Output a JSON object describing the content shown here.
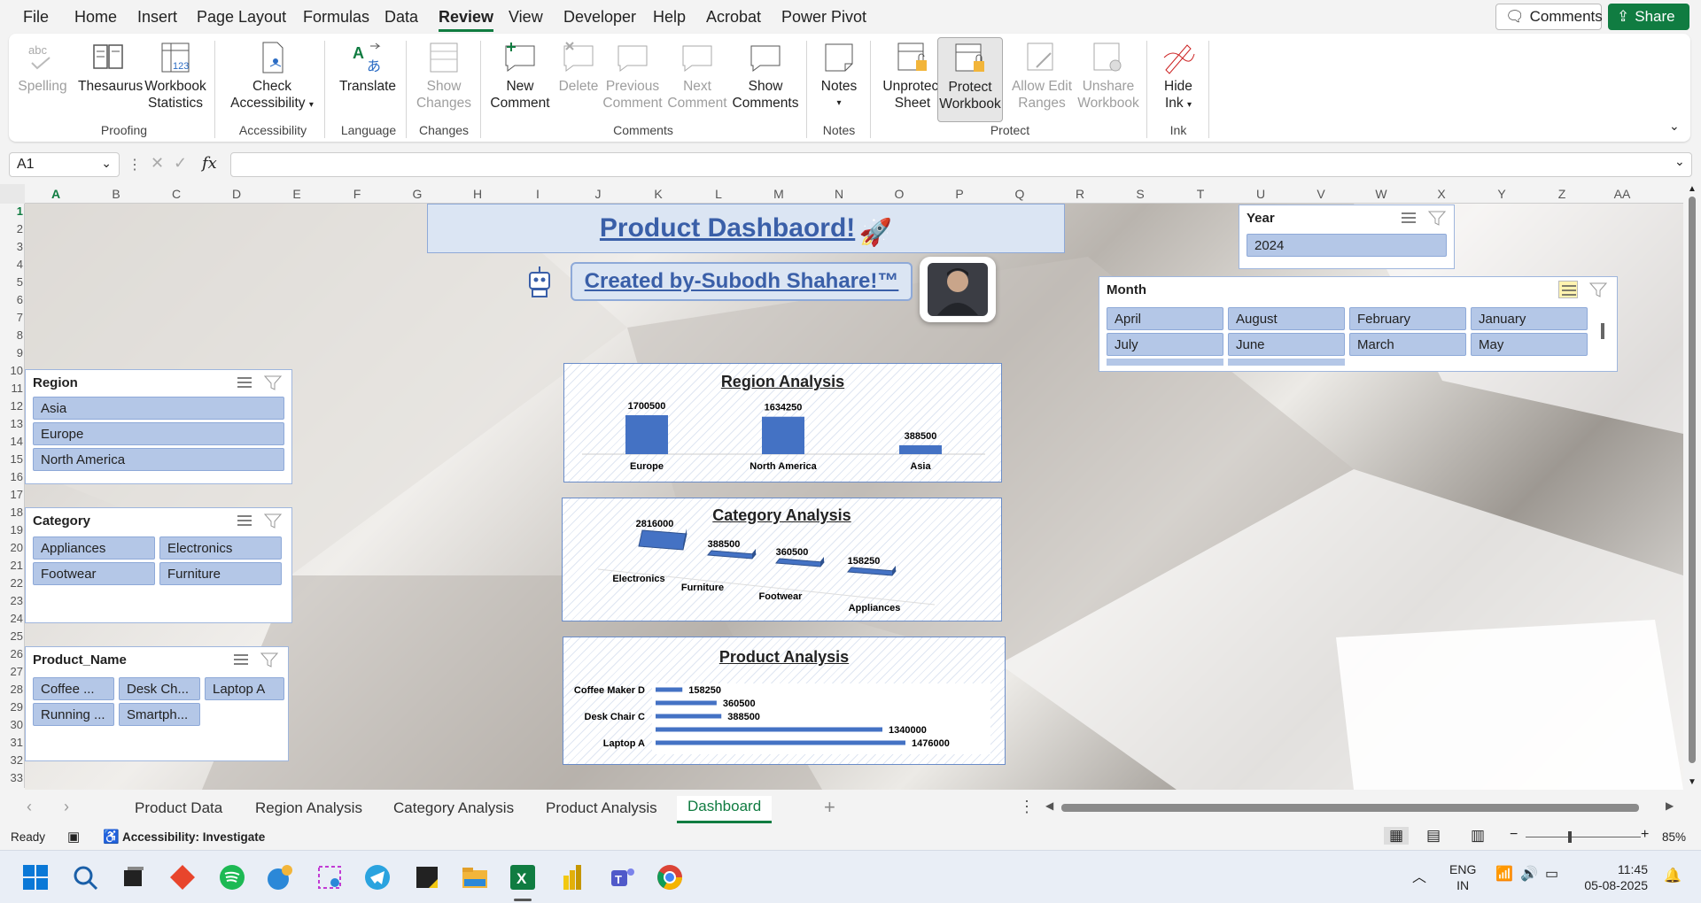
{
  "menu": {
    "tabs": [
      "File",
      "Home",
      "Insert",
      "Page Layout",
      "Formulas",
      "Data",
      "Review",
      "View",
      "Developer",
      "Help",
      "Acrobat",
      "Power Pivot"
    ],
    "comments_label": "Comments",
    "share_label": "Share"
  },
  "ribbon": {
    "spelling": "Spelling",
    "thesaurus": "Thesaurus",
    "workbook_stats_1": "Workbook",
    "workbook_stats_2": "Statistics",
    "check_access_1": "Check",
    "check_access_2": "Accessibility",
    "translate": "Translate",
    "show_changes_1": "Show",
    "show_changes_2": "Changes",
    "new_comment_1": "New",
    "new_comment_2": "Comment",
    "delete": "Delete",
    "previous_comment_1": "Previous",
    "previous_comment_2": "Comment",
    "next_comment_1": "Next",
    "next_comment_2": "Comment",
    "show_comments_1": "Show",
    "show_comments_2": "Comments",
    "notes": "Notes",
    "unprotect_1": "Unprotect",
    "unprotect_2": "Sheet",
    "protect_wb_1": "Protect",
    "protect_wb_2": "Workbook",
    "allow_edit_1": "Allow Edit",
    "allow_edit_2": "Ranges",
    "unshare_1": "Unshare",
    "unshare_2": "Workbook",
    "hide_ink_1": "Hide",
    "hide_ink_2": "Ink",
    "groups": {
      "proofing": "Proofing",
      "accessibility": "Accessibility",
      "language": "Language",
      "changes": "Changes",
      "comments": "Comments",
      "notes": "Notes",
      "protect": "Protect",
      "ink": "Ink"
    }
  },
  "formula_bar": {
    "name_box": "A1",
    "fx": "fx"
  },
  "columns": [
    "A",
    "B",
    "C",
    "D",
    "E",
    "F",
    "G",
    "H",
    "I",
    "J",
    "K",
    "L",
    "M",
    "N",
    "O",
    "P",
    "Q",
    "R",
    "S",
    "T",
    "U",
    "V",
    "W",
    "X",
    "Y",
    "Z",
    "AA"
  ],
  "rows": [
    "1",
    "2",
    "3",
    "4",
    "5",
    "6",
    "7",
    "8",
    "9",
    "10",
    "11",
    "12",
    "13",
    "14",
    "15",
    "16",
    "17",
    "18",
    "19",
    "20",
    "21",
    "22",
    "23",
    "24",
    "25",
    "26",
    "27",
    "28",
    "29",
    "30",
    "31",
    "32",
    "33"
  ],
  "dashboard": {
    "title": "Product Dashbaord!",
    "credit": "Created by-Subodh Shahare!™"
  },
  "slicers": {
    "region": {
      "title": "Region",
      "items": [
        "Asia",
        "Europe",
        "North America"
      ]
    },
    "category": {
      "title": "Category",
      "items": [
        "Appliances",
        "Electronics",
        "Footwear",
        "Furniture"
      ]
    },
    "product": {
      "title": "Product_Name",
      "items": [
        "Coffee ...",
        "Desk Ch...",
        "Laptop A",
        "Running ...",
        "Smartph..."
      ]
    },
    "year": {
      "title": "Year",
      "items": [
        "2024"
      ]
    },
    "month": {
      "title": "Month",
      "items": [
        "April",
        "August",
        "February",
        "January",
        "July",
        "June",
        "March",
        "May"
      ]
    }
  },
  "chart_data": [
    {
      "type": "bar",
      "title": "Region Analysis",
      "categories": [
        "Europe",
        "North America",
        "Asia"
      ],
      "values": [
        1700500,
        1634250,
        388500
      ]
    },
    {
      "type": "bar",
      "title": "Category Analysis",
      "categories": [
        "Electronics",
        "Furniture",
        "Footwear",
        "Appliances"
      ],
      "values": [
        2816000,
        388500,
        360500,
        158250
      ]
    },
    {
      "type": "bar",
      "title": "Product  Analysis",
      "categories": [
        "Coffee Maker D",
        "",
        "Desk Chair C",
        "",
        "Laptop A"
      ],
      "values": [
        158250,
        360500,
        388500,
        1340000,
        1476000
      ]
    }
  ],
  "sheet_tabs": [
    "Product Data",
    "Region Analysis",
    "Category Analysis",
    "Product Analysis",
    "Dashboard"
  ],
  "status": {
    "ready": "Ready",
    "accessibility": "Accessibility: Investigate",
    "zoom": "85%"
  },
  "taskbar": {
    "lang_1": "ENG",
    "lang_2": "IN",
    "time": "11:45",
    "date": "05-08-2025"
  }
}
